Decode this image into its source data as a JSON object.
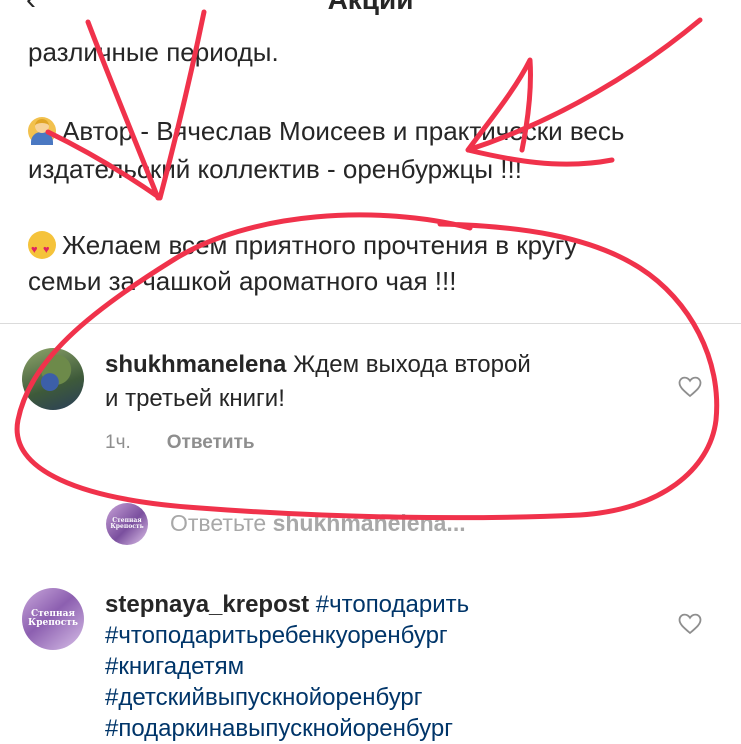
{
  "header": {
    "title": "Акции"
  },
  "caption": {
    "line1": "различные периоды.",
    "line2": "Автор - Вячеслав Моисеев  и практически весь",
    "line3": "издательский коллектив - оренбуржцы !!!",
    "line4": "Желаем всем приятного прочтения в кругу",
    "line5": "семьи за чашкой ароматного чая !!!"
  },
  "comments": [
    {
      "username": "shukhmanelena",
      "text_line1": "Ждем выхода второй",
      "text_line2": "и третьей книги!",
      "time": "1ч.",
      "reply_label": "Ответить"
    },
    {
      "username": "stepnaya_krepost",
      "hashtags": [
        "#чтоподарить",
        "#чтоподаритьребенкуоренбург",
        "#книгадетям",
        "#детскийвыпускнойоренбург",
        "#подаркинавыпускнойоренбург"
      ],
      "avatar_text": "Степная Крепость"
    }
  ],
  "reply_prompt": {
    "prefix": "Ответьте",
    "username": "shukhmanelena..."
  },
  "colors": {
    "annotation_red": "#f0324b",
    "hashtag": "#003569",
    "meta_gray": "#8e8e8e"
  }
}
